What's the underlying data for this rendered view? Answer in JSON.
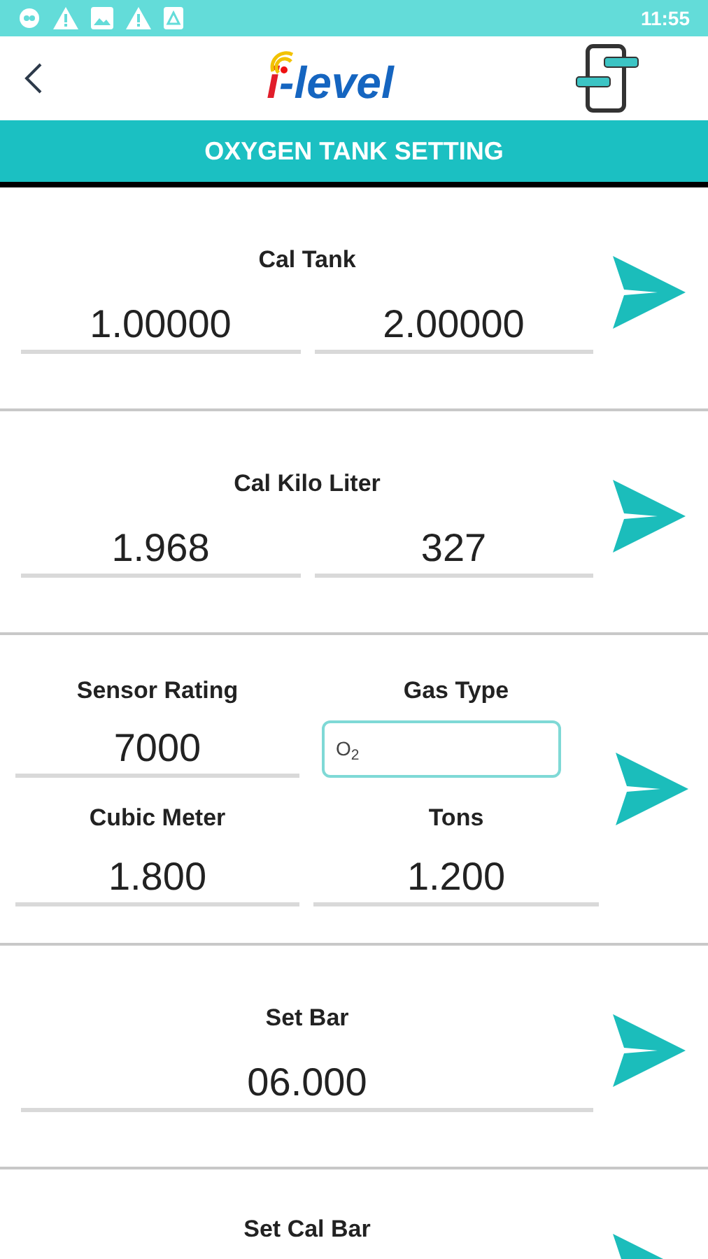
{
  "status_bar": {
    "time": "11:55"
  },
  "header": {
    "logo_prefix": "i",
    "logo_suffix": "-level"
  },
  "title": "OXYGEN TANK SETTING",
  "sections": [
    {
      "kind": "double",
      "label": "Cal Tank",
      "values": [
        "1.00000",
        "2.00000"
      ]
    },
    {
      "kind": "double",
      "label": "Cal Kilo Liter",
      "values": [
        "1.968",
        "327"
      ]
    },
    {
      "kind": "grid",
      "cells": [
        {
          "kind": "line",
          "label": "Sensor Rating",
          "value": "7000"
        },
        {
          "kind": "box",
          "label": "Gas Type",
          "value": "O$_{2}$"
        },
        {
          "kind": "line",
          "label": "Cubic Meter",
          "value": "1.800"
        },
        {
          "kind": "line",
          "label": "Tons",
          "value": "1.200"
        }
      ]
    },
    {
      "kind": "single",
      "label": "Set Bar",
      "values": [
        "06.000"
      ]
    },
    {
      "kind": "label_only",
      "label": "Set Cal Bar"
    }
  ]
}
